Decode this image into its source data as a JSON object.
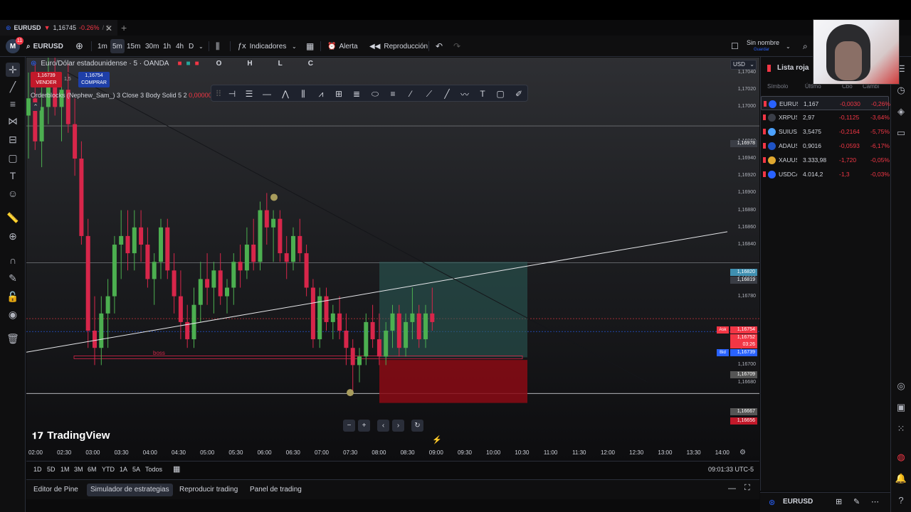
{
  "browser_tab": {
    "symbol": "EURUSD",
    "arrow": "▼",
    "price": "1,16745",
    "change": "-0.26%",
    "rest": "/ S"
  },
  "toolbar": {
    "avatar": "M",
    "avatar_badge": "11",
    "symbol": "EURUSD",
    "timeframes": [
      "1m",
      "5m",
      "15m",
      "30m",
      "1h",
      "4h",
      "D"
    ],
    "active_timeframe": "5m",
    "indicators": "Indicadores",
    "alert": "Alerta",
    "replay": "Reproducción",
    "layout_name": "Sin nombre",
    "layout_sub": "Guardar"
  },
  "chart": {
    "title": "Euro/Dólar estadounidense · 5 · OANDA",
    "ohlc_o": "O",
    "ohlc_h": "H",
    "ohlc_l": "L",
    "ohlc_c": "C",
    "sell_price": "1,16739",
    "sell_label": "VENDER",
    "spread": "1,5",
    "buy_price": "1,16754",
    "buy_label": "COMPRAR",
    "indicator": "Orderblocks (Nephew_Sam_) 3 Close 3 Body Solid 5 2",
    "indicator_value": "0,00000",
    "boss_label": "boss",
    "currency": "USD",
    "watermark": "TradingView",
    "price_labels": [
      "1,17040",
      "1,17020",
      "1,17000",
      "1,16960",
      "1,16940",
      "1,16920",
      "1,16900",
      "1,16880",
      "1,16860",
      "1,16840",
      "1,16800",
      "1,16780",
      "1,16720",
      "1,16700",
      "1,16680",
      "1,16644"
    ],
    "price_tags": {
      "top_line": "1,16978",
      "tp_line": "1,16820",
      "level": "1,16819",
      "ask_label": "Ask",
      "ask": "1,16754",
      "current": "1,16752",
      "countdown": "03:26",
      "bid_label": "Bid",
      "bid": "1,16739",
      "entry": "1,16709",
      "low_line": "1,16667",
      "stop": "1,16656"
    },
    "time_labels": [
      "02:00",
      "02:30",
      "03:00",
      "03:30",
      "04:00",
      "04:30",
      "05:00",
      "05:30",
      "06:00",
      "06:30",
      "07:00",
      "07:30",
      "08:00",
      "08:30",
      "09:00",
      "09:30",
      "10:00",
      "10:30",
      "11:00",
      "11:30",
      "12:00",
      "12:30",
      "13:00",
      "13:30",
      "14:00"
    ],
    "ranges": [
      "1D",
      "5D",
      "1M",
      "3M",
      "6M",
      "YTD",
      "1A",
      "5A",
      "Todos"
    ],
    "clock": "09:01:33 UTC-5"
  },
  "bottom_tabs": [
    "Editor de Pine",
    "Simulador de estrategias",
    "Reproducir trading",
    "Panel de trading"
  ],
  "bottom_active": "Simulador de estrategias",
  "watchlist": {
    "title": "Lista roja",
    "headers": [
      "Símbolo",
      "Último",
      "Cbo",
      "Cambi"
    ],
    "rows": [
      {
        "sym": "EURUSD",
        "last": "1,167",
        "chg": "-0,0030",
        "pct": "-0,26%",
        "color": "#2962ff"
      },
      {
        "sym": "XRPUSD",
        "last": "2,97",
        "chg": "-0,1125",
        "pct": "-3,64%",
        "color": "#3a3e48"
      },
      {
        "sym": "SUIUSD",
        "last": "3,5475",
        "chg": "-0,2164",
        "pct": "-5,75%",
        "color": "#4ca2ff"
      },
      {
        "sym": "ADAUSD",
        "last": "0,9016",
        "chg": "-0,0593",
        "pct": "-6,17%",
        "color": "#1f53c5"
      },
      {
        "sym": "XAUUSD",
        "last": "3.333,98",
        "chg": "-1,720",
        "pct": "-0,05%",
        "color": "#e0a830"
      },
      {
        "sym": "USDCAD",
        "last": "4.014,2",
        "chg": "-1,3",
        "pct": "-0,03%",
        "color": "#2962ff"
      }
    ],
    "footer_symbol": "EURUSD"
  },
  "colors": {
    "bull": "#26a69a",
    "bull_candle": "#4caf50",
    "bear": "#d7264a",
    "accent": "#2962ff"
  }
}
